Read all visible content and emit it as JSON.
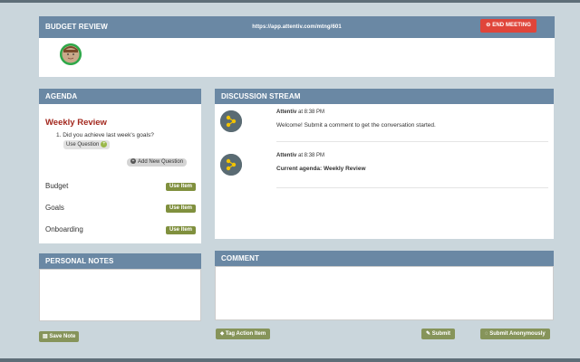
{
  "meeting": {
    "title": "BUDGET REVIEW",
    "url": "https://app.attentiv.com/mtng/601",
    "end_button": "END MEETING"
  },
  "agenda": {
    "header": "AGENDA",
    "current_title": "Weekly Review",
    "question_number": "1.",
    "question": "Did you achieve last week's goals?",
    "use_question_label": "Use Question",
    "add_question_label": "Add New Question",
    "items": [
      {
        "label": "Budget",
        "button": "Use Item"
      },
      {
        "label": "Goals",
        "button": "Use Item"
      },
      {
        "label": "Onboarding",
        "button": "Use Item"
      }
    ]
  },
  "notes": {
    "header": "PERSONAL NOTES",
    "value": "",
    "save_label": "Save Note"
  },
  "discussion": {
    "header": "DISCUSSION STREAM",
    "messages": [
      {
        "author": "Attentiv",
        "time": "at 8:38 PM",
        "text": "Welcome! Submit a comment to get the conversation started."
      },
      {
        "author": "Attentiv",
        "time": "at 8:38 PM",
        "text": "Current agenda: Weekly Review"
      }
    ]
  },
  "comment": {
    "header": "COMMENT",
    "value": "",
    "tag_label": "Tag Action Item",
    "submit_label": "Submit",
    "anon_label": "Submit Anonymously"
  },
  "colors": {
    "header": "#6a88a4",
    "background": "#cad6dc",
    "end_button": "#e0453a",
    "accent_title": "#a3281e",
    "button_olive": "#80903e"
  }
}
